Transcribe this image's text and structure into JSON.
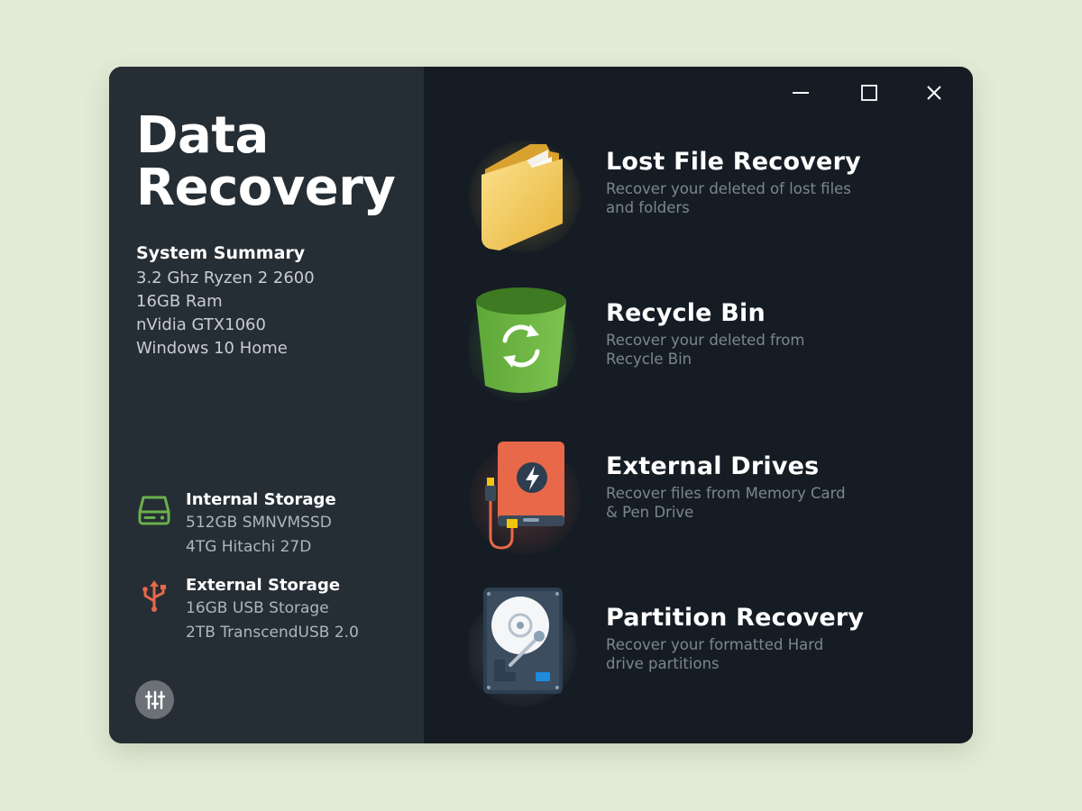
{
  "app": {
    "title_line1": "Data",
    "title_line2": "Recovery"
  },
  "summary": {
    "heading": "System Summary",
    "items": [
      "3.2 Ghz Ryzen 2 2600",
      "16GB Ram",
      "nVidia GTX1060",
      "Windows 10 Home"
    ]
  },
  "internal_storage": {
    "heading": "Internal Storage",
    "items": [
      "512GB SMNVMSSD",
      "4TG Hitachi 27D"
    ],
    "icon": "hard-drive-icon",
    "color": "#6ab04c"
  },
  "external_storage": {
    "heading": "External Storage",
    "items": [
      "16GB USB Storage",
      "2TB TranscendUSB 2.0"
    ],
    "icon": "usb-icon",
    "color": "#e8684a"
  },
  "cards": [
    {
      "title": "Lost File Recovery",
      "desc": "Recover your deleted of lost files and folders",
      "icon": "folder-icon"
    },
    {
      "title": "Recycle Bin",
      "desc": "Recover your deleted from Recycle Bin",
      "icon": "recycle-bin-icon"
    },
    {
      "title": "External Drives",
      "desc": "Recover files from Memory Card & Pen Drive",
      "icon": "external-drive-icon"
    },
    {
      "title": "Partition Recovery",
      "desc": "Recover your formatted Hard drive partitions",
      "icon": "hard-disk-icon"
    }
  ],
  "colors": {
    "background": "#e2ecd6",
    "sidebar": "#262e35",
    "main": "#151c24"
  }
}
